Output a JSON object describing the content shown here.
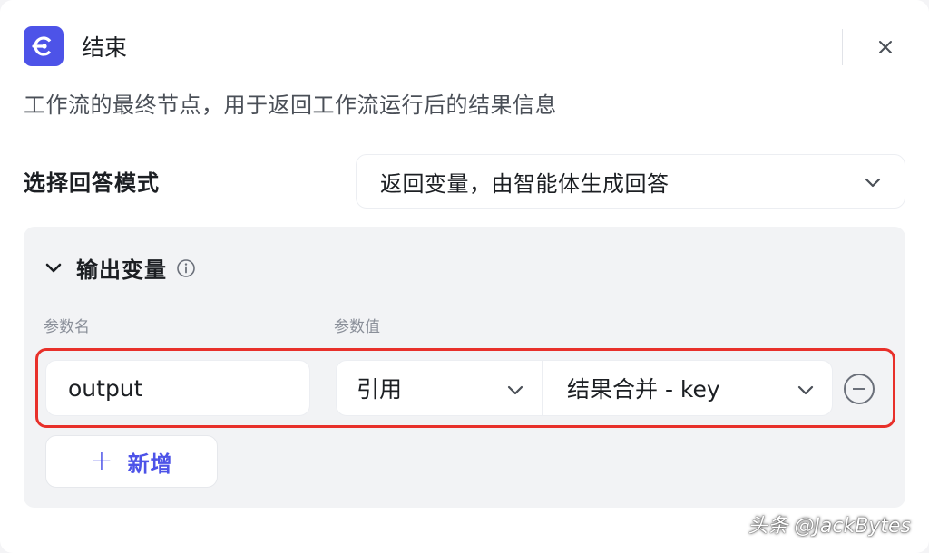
{
  "header": {
    "title": "结束",
    "node_icon": "end-node-icon",
    "close_icon": "close-icon"
  },
  "description": "工作流的最终节点，用于返回工作流运行后的结果信息",
  "answer_mode": {
    "label": "选择回答模式",
    "selected": "返回变量，由智能体生成回答"
  },
  "output_variables": {
    "title": "输出变量",
    "columns": {
      "name": "参数名",
      "value": "参数值"
    },
    "rows": [
      {
        "name": "output",
        "type": "引用",
        "reference": "结果合并 - key"
      }
    ],
    "add_label": "新增"
  },
  "watermark": "头条 @JackBytes",
  "colors": {
    "accent": "#4d53e8",
    "highlight": "#e8302a",
    "section_bg": "#f2f3f5"
  }
}
